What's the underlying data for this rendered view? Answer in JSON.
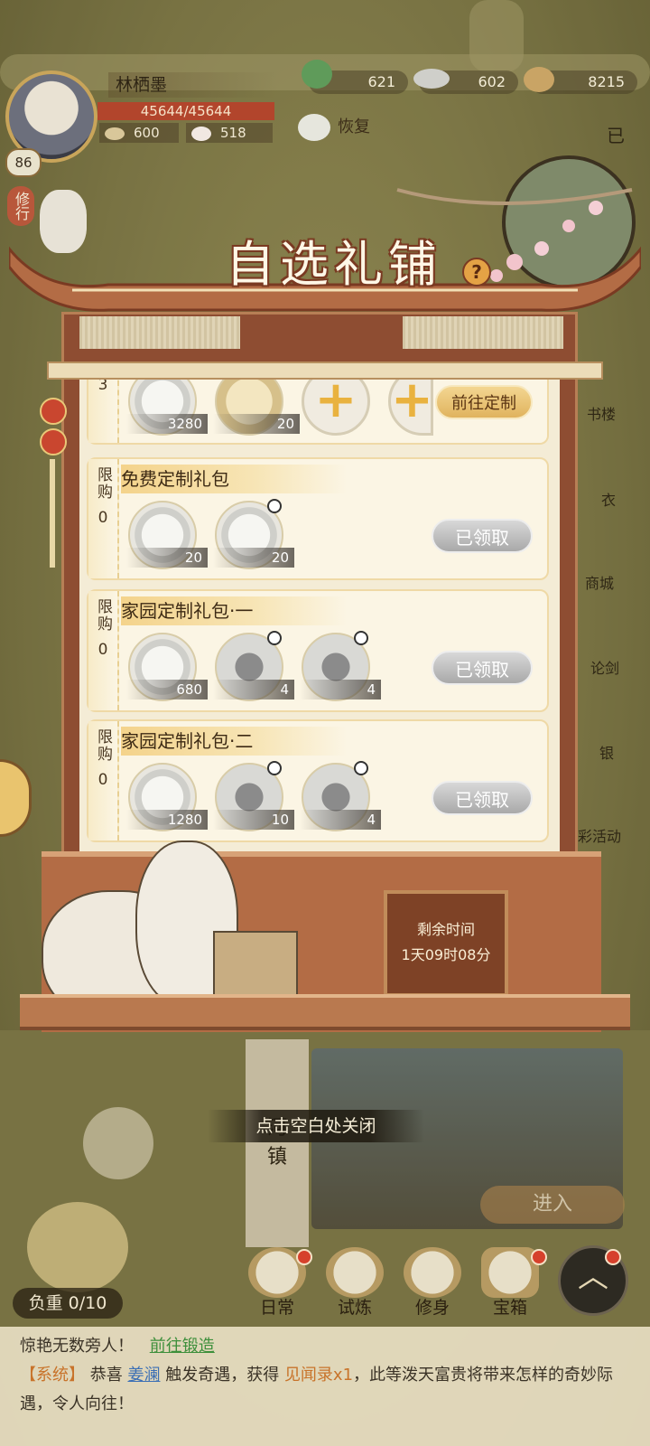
{
  "player": {
    "name": "林栖墨",
    "level": "86",
    "hp": "45644/45644",
    "stat_a": "600",
    "stat_b": "518",
    "recover_label": "恢复"
  },
  "resources": [
    {
      "icon": "cabbage-icon",
      "value": "621"
    },
    {
      "icon": "silver-ingot-icon",
      "value": "602"
    },
    {
      "icon": "coin-string-icon",
      "value": "8215"
    }
  ],
  "side": {
    "cultivate_tag": "修行",
    "right_top": "已",
    "right_labels": [
      "书楼",
      "衣",
      "商城",
      "论剑",
      "银",
      "彩活动"
    ]
  },
  "shop": {
    "title": "自选礼铺",
    "help_icon": "question-mark-icon",
    "top_partial": {
      "limit": "3",
      "items": [
        {
          "icon": "silver-ingot-icon",
          "qty": "3280"
        },
        {
          "icon": "scroll-book-icon",
          "qty": "20"
        }
      ],
      "button": "前往定制"
    },
    "packs": [
      {
        "limit_label": "限购",
        "limit_count": "0",
        "title": "免费定制礼包",
        "items": [
          {
            "icon": "silver-ingot-icon",
            "qty": "20"
          },
          {
            "icon": "silver-ingot-icon",
            "qty": "20"
          }
        ],
        "button": "已领取"
      },
      {
        "limit_label": "限购",
        "limit_count": "0",
        "title": "家园定制礼包·一",
        "items": [
          {
            "icon": "silver-ingot-icon",
            "qty": "680"
          },
          {
            "icon": "lily-flower-icon",
            "qty": "4"
          },
          {
            "icon": "lily-flower-icon",
            "qty": "4"
          }
        ],
        "button": "已领取"
      },
      {
        "limit_label": "限购",
        "limit_count": "0",
        "title": "家园定制礼包·二",
        "items": [
          {
            "icon": "silver-ingot-icon",
            "qty": "1280"
          },
          {
            "icon": "lily-flower-icon",
            "qty": "10"
          },
          {
            "icon": "lily-flower-icon",
            "qty": "4"
          }
        ],
        "button": "已领取"
      }
    ],
    "timer_label": "剩余时间",
    "timer_value": "1天09时08分"
  },
  "close_hint": "点击空白处关闭",
  "town": {
    "name_partial": "河\n镇",
    "enter_button": "进入"
  },
  "load": "负重 0/10",
  "nav": [
    {
      "label": "日常",
      "icon": "daily-icon"
    },
    {
      "label": "试炼",
      "icon": "trial-icon"
    },
    {
      "label": "修身",
      "icon": "cultivate-icon"
    },
    {
      "label": "宝箱",
      "icon": "treasure-chest-icon"
    }
  ],
  "chat": {
    "line1_text": "惊艳无数旁人！",
    "line1_link": "前往锻造",
    "sys_tag": "【系统】",
    "pre": "恭喜",
    "player": "姜澜",
    "mid": "触发奇遇，获得",
    "item": "见闻录x1",
    "post": "，此等泼天富贵将带来怎样的奇妙际遇，令人向往！"
  }
}
